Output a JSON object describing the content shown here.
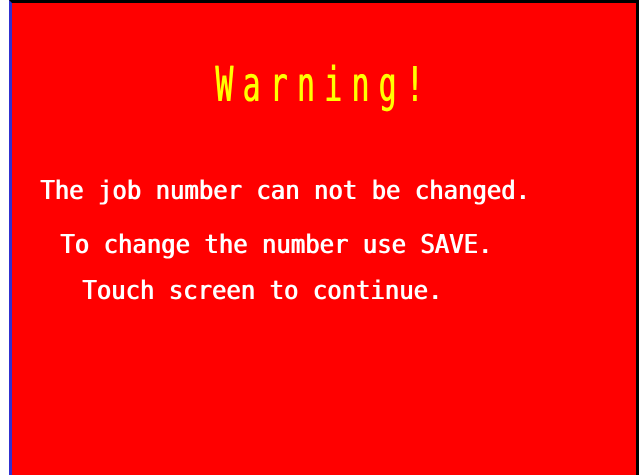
{
  "warning": {
    "title": "Warning!",
    "messages": [
      "The job number can not be changed.",
      "To change the number use SAVE.",
      "Touch screen to continue."
    ]
  },
  "colors": {
    "background": "#ff0000",
    "title": "#ffff00",
    "text": "#ffffff"
  }
}
